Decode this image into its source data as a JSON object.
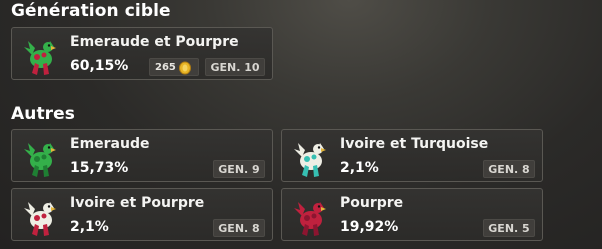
{
  "sections": {
    "target_title": "Génération cible",
    "others_title": "Autres"
  },
  "target": {
    "name": "Emeraude et Pourpre",
    "percent": "60,15%",
    "cost": "265",
    "generation": "GEN. 10",
    "colors": [
      "#34b04a",
      "#c0213e"
    ]
  },
  "others": [
    {
      "name": "Emeraude",
      "percent": "15,73%",
      "generation": "GEN. 9",
      "colors": [
        "#34b04a",
        "#1f7f33"
      ]
    },
    {
      "name": "Ivoire et Turquoise",
      "percent": "2,1%",
      "generation": "GEN. 8",
      "colors": [
        "#eeeee4",
        "#36bfb2"
      ]
    },
    {
      "name": "Ivoire et Pourpre",
      "percent": "2,1%",
      "generation": "GEN. 8",
      "colors": [
        "#eeeee4",
        "#c0213e"
      ]
    },
    {
      "name": "Pourpre",
      "percent": "19,92%",
      "generation": "GEN. 5",
      "colors": [
        "#c0213e",
        "#8c1530"
      ]
    }
  ],
  "icons": {
    "avatar": "dragoturkey-icon",
    "cost": "coin-icon"
  }
}
